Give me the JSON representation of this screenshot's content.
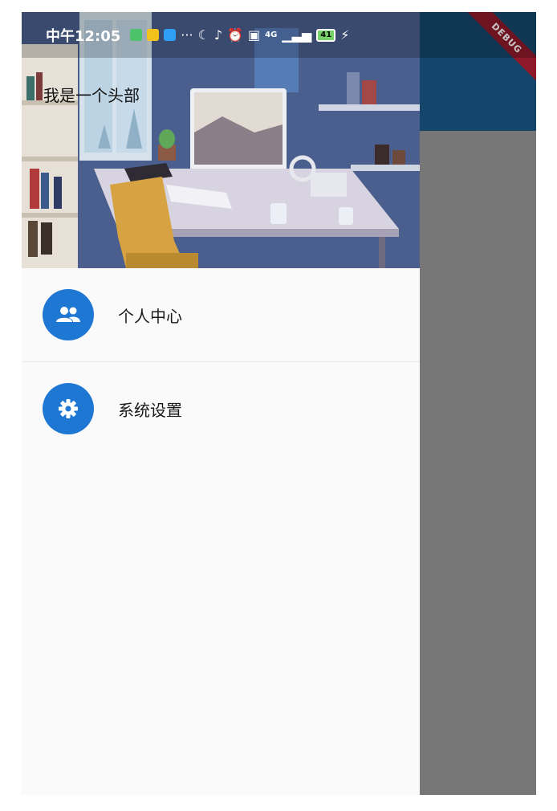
{
  "status_bar": {
    "time": "中午12:05",
    "more": "···",
    "network": "4G",
    "battery": "41"
  },
  "debug_banner": "DEBUG",
  "drawer": {
    "header_title": "我是一个头部",
    "items": [
      {
        "label": "个人中心",
        "icon": "people-icon"
      },
      {
        "label": "系统设置",
        "icon": "settings-gear-icon"
      }
    ]
  },
  "colors": {
    "accent": "#1f77d4",
    "appbar": "#14466b",
    "scrim": "#777777",
    "debug": "#8e1a29",
    "drawer_bg": "#fafafa"
  }
}
